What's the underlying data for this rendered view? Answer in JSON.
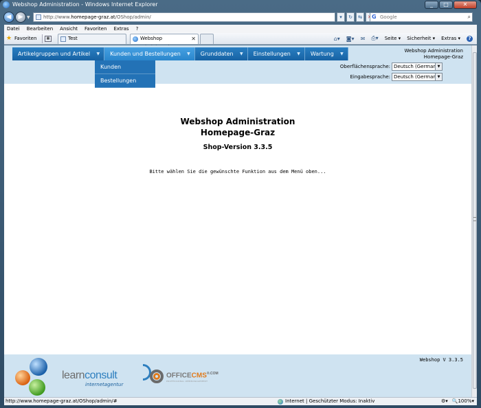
{
  "window": {
    "title": "Webshop Administration - Windows Internet Explorer",
    "buttons": {
      "minimize": "_",
      "maximize": "□",
      "close": "✕"
    }
  },
  "address": {
    "prefix": "http://www.",
    "host": "homepage-graz.at",
    "path": "/OShop/admin/",
    "search_placeholder": "Google"
  },
  "menubar": [
    "Datei",
    "Bearbeiten",
    "Ansicht",
    "Favoriten",
    "Extras",
    "?"
  ],
  "favbar": {
    "favorites_label": "Favoriten",
    "tabs": [
      {
        "label": "Test"
      },
      {
        "label": "Webshop Administration"
      }
    ],
    "commands": {
      "page": "Seite",
      "security": "Sicherheit",
      "extras": "Extras"
    }
  },
  "nav": {
    "items": [
      {
        "label": "Artikelgruppen und Artikel"
      },
      {
        "label": "Kunden und Bestellungen"
      },
      {
        "label": "Grunddaten"
      },
      {
        "label": "Einstellungen"
      },
      {
        "label": "Wartung"
      }
    ],
    "dropdown": [
      "Kunden",
      "Bestellungen"
    ]
  },
  "header": {
    "brand_line1": "Webshop Administration",
    "brand_line2": "Homepage-Graz",
    "ui_language_label": "Oberflächensprache:",
    "ui_language_value": "Deutsch (German)",
    "input_language_label": "Eingabesprache:",
    "input_language_value": "Deutsch (German)"
  },
  "main": {
    "title_line1": "Webshop Administration",
    "title_line2": "Homepage-Graz",
    "version": "Shop-Version 3.3.5",
    "hint": "Bitte wählen Sie die gewünschte Funktion aus dem Menü oben..."
  },
  "footer": {
    "version": "Webshop V 3.3.5",
    "logo1_learn": "learn",
    "logo1_consult": "consult",
    "logo1_sub": "internetagentur",
    "logo2_office": "OFFICE",
    "logo2_cms": "CMS",
    "logo2_com": "®.COM",
    "logo2_tagline": "PROFESSIONAL WEBMANAGEMENT"
  },
  "statusbar": {
    "url": "http://www.homepage-graz.at/OShop/admin/#",
    "zone": "Internet | Geschützter Modus: Inaktiv",
    "zoom": "100%"
  },
  "colors": {
    "nav_bg": "#1762a3",
    "nav_active": "#2a86cc",
    "band_bg": "#cfe3f1"
  }
}
